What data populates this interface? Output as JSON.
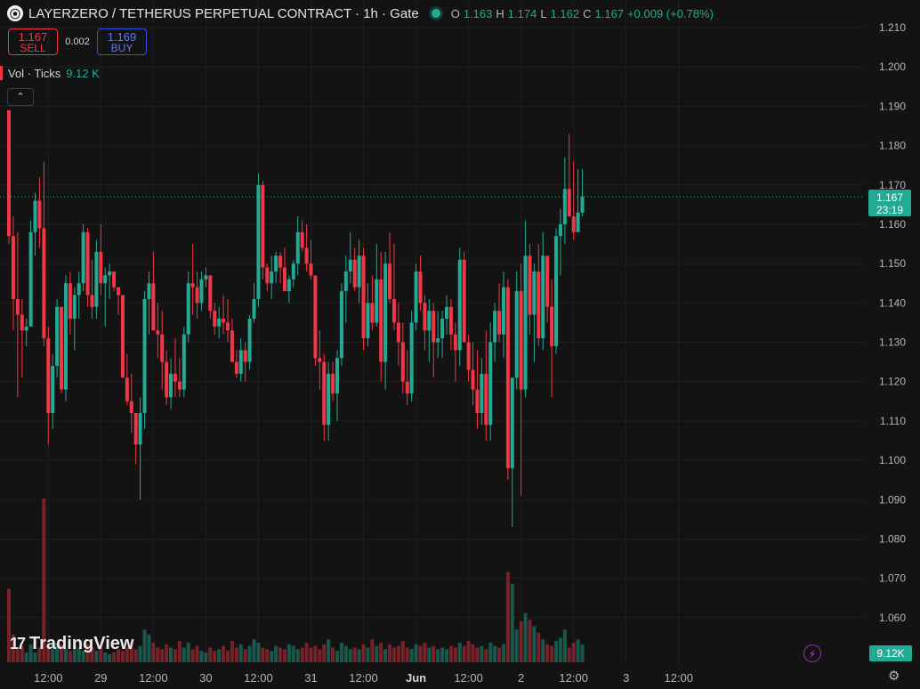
{
  "header": {
    "logo_letter": "⦿",
    "title": "LAYERZERO / TETHERUS PERPETUAL CONTRACT · 1h · Gate",
    "ohlc": {
      "o_label": "O",
      "o": "1.163",
      "h_label": "H",
      "h": "1.174",
      "l_label": "L",
      "l": "1.162",
      "c_label": "C",
      "c": "1.167",
      "change": "+0.009 (+0.78%)"
    }
  },
  "trade": {
    "sell_price": "1.167",
    "sell_label": "SELL",
    "spread": "0.002",
    "buy_price": "1.169",
    "buy_label": "BUY"
  },
  "volume_legend": {
    "label": "Vol · Ticks",
    "value": "9.12 K"
  },
  "brand": {
    "name": "TradingView",
    "mark": "17"
  },
  "colors": {
    "up": "#22ab94",
    "down": "#f23645",
    "background": "#131313",
    "grid": "#1f1f1f",
    "axis_text": "#b2b5be"
  },
  "icons": [
    "tradingview-logo-icon",
    "chevron-up-icon",
    "lightning-icon",
    "settings-icon"
  ],
  "chart_data": {
    "type": "candlestick",
    "interval": "1h",
    "ylim": [
      1.05,
      1.21
    ],
    "y_ticks": [
      "1.210",
      "1.200",
      "1.190",
      "1.180",
      "1.170",
      "1.160",
      "1.150",
      "1.140",
      "1.130",
      "1.120",
      "1.110",
      "1.100",
      "1.090",
      "1.080",
      "1.070",
      "1.060"
    ],
    "x_ticks": [
      "12:00",
      "29",
      "12:00",
      "30",
      "12:00",
      "31",
      "12:00",
      "Jun",
      "12:00",
      "2",
      "12:00",
      "3",
      "12:00"
    ],
    "x_tick_bars": [
      9,
      21,
      33,
      45,
      57,
      69,
      81,
      93,
      105,
      117,
      129,
      141,
      153
    ],
    "last_price": "1.167",
    "countdown": "23:19",
    "volume_last": "9.12K",
    "volume_max": 100,
    "candles": [
      [
        1.189,
        1.189,
        1.155,
        1.157,
        45
      ],
      [
        1.157,
        1.162,
        1.133,
        1.141,
        17
      ],
      [
        1.141,
        1.158,
        1.116,
        1.137,
        8
      ],
      [
        1.137,
        1.141,
        1.121,
        1.133,
        10
      ],
      [
        1.133,
        1.136,
        1.129,
        1.134,
        6
      ],
      [
        1.134,
        1.161,
        1.134,
        1.158,
        11
      ],
      [
        1.158,
        1.168,
        1.152,
        1.166,
        6
      ],
      [
        1.166,
        1.172,
        1.154,
        1.159,
        9
      ],
      [
        1.159,
        1.176,
        1.129,
        1.131,
        100
      ],
      [
        1.131,
        1.134,
        1.104,
        1.112,
        10
      ],
      [
        1.112,
        1.127,
        1.108,
        1.124,
        8
      ],
      [
        1.124,
        1.141,
        1.121,
        1.139,
        12
      ],
      [
        1.139,
        1.139,
        1.117,
        1.118,
        11
      ],
      [
        1.118,
        1.147,
        1.115,
        1.145,
        8
      ],
      [
        1.145,
        1.148,
        1.132,
        1.136,
        7
      ],
      [
        1.136,
        1.144,
        1.128,
        1.142,
        11
      ],
      [
        1.142,
        1.148,
        1.136,
        1.145,
        9
      ],
      [
        1.145,
        1.16,
        1.143,
        1.158,
        7
      ],
      [
        1.158,
        1.159,
        1.139,
        1.142,
        11
      ],
      [
        1.142,
        1.151,
        1.136,
        1.139,
        9
      ],
      [
        1.139,
        1.156,
        1.136,
        1.153,
        7
      ],
      [
        1.153,
        1.16,
        1.142,
        1.145,
        10
      ],
      [
        1.145,
        1.149,
        1.134,
        1.147,
        6
      ],
      [
        1.147,
        1.15,
        1.141,
        1.148,
        5
      ],
      [
        1.148,
        1.147,
        1.143,
        1.144,
        6
      ],
      [
        1.144,
        1.143,
        1.137,
        1.142,
        8
      ],
      [
        1.142,
        1.14,
        1.128,
        1.121,
        7
      ],
      [
        1.121,
        1.127,
        1.114,
        1.115,
        9
      ],
      [
        1.115,
        1.122,
        1.107,
        1.112,
        12
      ],
      [
        1.112,
        1.108,
        1.099,
        1.104,
        8
      ],
      [
        1.104,
        1.116,
        1.09,
        1.112,
        10
      ],
      [
        1.112,
        1.143,
        1.108,
        1.141,
        20
      ],
      [
        1.141,
        1.148,
        1.132,
        1.145,
        17
      ],
      [
        1.145,
        1.153,
        1.14,
        1.133,
        12
      ],
      [
        1.133,
        1.14,
        1.126,
        1.132,
        9
      ],
      [
        1.132,
        1.138,
        1.118,
        1.125,
        8
      ],
      [
        1.125,
        1.128,
        1.114,
        1.116,
        11
      ],
      [
        1.116,
        1.126,
        1.113,
        1.122,
        9
      ],
      [
        1.122,
        1.131,
        1.116,
        1.12,
        8
      ],
      [
        1.12,
        1.126,
        1.116,
        1.118,
        13
      ],
      [
        1.118,
        1.134,
        1.116,
        1.132,
        9
      ],
      [
        1.132,
        1.148,
        1.13,
        1.145,
        12
      ],
      [
        1.145,
        1.155,
        1.137,
        1.144,
        8
      ],
      [
        1.144,
        1.148,
        1.136,
        1.14,
        10
      ],
      [
        1.14,
        1.148,
        1.138,
        1.146,
        7
      ],
      [
        1.146,
        1.149,
        1.144,
        1.147,
        6
      ],
      [
        1.147,
        1.14,
        1.136,
        1.138,
        9
      ],
      [
        1.138,
        1.14,
        1.132,
        1.134,
        7
      ],
      [
        1.134,
        1.139,
        1.131,
        1.136,
        8
      ],
      [
        1.136,
        1.142,
        1.132,
        1.135,
        10
      ],
      [
        1.135,
        1.141,
        1.13,
        1.133,
        7
      ],
      [
        1.133,
        1.136,
        1.128,
        1.125,
        13
      ],
      [
        1.125,
        1.128,
        1.121,
        1.122,
        9
      ],
      [
        1.122,
        1.131,
        1.12,
        1.128,
        11
      ],
      [
        1.128,
        1.13,
        1.12,
        1.125,
        8
      ],
      [
        1.125,
        1.137,
        1.123,
        1.136,
        10
      ],
      [
        1.136,
        1.145,
        1.135,
        1.141,
        14
      ],
      [
        1.141,
        1.173,
        1.139,
        1.17,
        12
      ],
      [
        1.17,
        1.171,
        1.146,
        1.149,
        9
      ],
      [
        1.149,
        1.15,
        1.143,
        1.145,
        8
      ],
      [
        1.145,
        1.152,
        1.141,
        1.148,
        7
      ],
      [
        1.148,
        1.153,
        1.145,
        1.152,
        10
      ],
      [
        1.152,
        1.153,
        1.145,
        1.149,
        9
      ],
      [
        1.149,
        1.154,
        1.144,
        1.143,
        8
      ],
      [
        1.143,
        1.147,
        1.14,
        1.146,
        11
      ],
      [
        1.146,
        1.151,
        1.144,
        1.15,
        10
      ],
      [
        1.15,
        1.162,
        1.147,
        1.158,
        8
      ],
      [
        1.158,
        1.161,
        1.153,
        1.154,
        9
      ],
      [
        1.154,
        1.16,
        1.148,
        1.15,
        12
      ],
      [
        1.15,
        1.156,
        1.146,
        1.147,
        9
      ],
      [
        1.147,
        1.139,
        1.124,
        1.126,
        10
      ],
      [
        1.126,
        1.133,
        1.118,
        1.125,
        8
      ],
      [
        1.125,
        1.127,
        1.105,
        1.109,
        11
      ],
      [
        1.109,
        1.125,
        1.105,
        1.122,
        14
      ],
      [
        1.122,
        1.125,
        1.115,
        1.117,
        9
      ],
      [
        1.117,
        1.128,
        1.11,
        1.126,
        7
      ],
      [
        1.126,
        1.145,
        1.124,
        1.143,
        12
      ],
      [
        1.143,
        1.152,
        1.135,
        1.148,
        10
      ],
      [
        1.148,
        1.158,
        1.145,
        1.151,
        8
      ],
      [
        1.151,
        1.154,
        1.143,
        1.144,
        9
      ],
      [
        1.144,
        1.156,
        1.14,
        1.152,
        8
      ],
      [
        1.152,
        1.154,
        1.128,
        1.131,
        11
      ],
      [
        1.131,
        1.145,
        1.129,
        1.14,
        9
      ],
      [
        1.14,
        1.147,
        1.133,
        1.135,
        14
      ],
      [
        1.135,
        1.155,
        1.134,
        1.146,
        10
      ],
      [
        1.146,
        1.153,
        1.12,
        1.125,
        12
      ],
      [
        1.125,
        1.153,
        1.118,
        1.15,
        8
      ],
      [
        1.15,
        1.158,
        1.14,
        1.141,
        11
      ],
      [
        1.141,
        1.155,
        1.133,
        1.135,
        9
      ],
      [
        1.135,
        1.14,
        1.124,
        1.13,
        10
      ],
      [
        1.13,
        1.135,
        1.117,
        1.12,
        13
      ],
      [
        1.12,
        1.128,
        1.114,
        1.117,
        9
      ],
      [
        1.117,
        1.138,
        1.115,
        1.135,
        8
      ],
      [
        1.135,
        1.15,
        1.133,
        1.148,
        11
      ],
      [
        1.148,
        1.152,
        1.138,
        1.14,
        10
      ],
      [
        1.14,
        1.142,
        1.128,
        1.133,
        12
      ],
      [
        1.133,
        1.141,
        1.125,
        1.138,
        9
      ],
      [
        1.138,
        1.14,
        1.121,
        1.13,
        10
      ],
      [
        1.13,
        1.138,
        1.126,
        1.131,
        8
      ],
      [
        1.131,
        1.138,
        1.126,
        1.136,
        9
      ],
      [
        1.136,
        1.142,
        1.132,
        1.139,
        8
      ],
      [
        1.139,
        1.141,
        1.128,
        1.132,
        10
      ],
      [
        1.132,
        1.135,
        1.12,
        1.128,
        9
      ],
      [
        1.128,
        1.154,
        1.124,
        1.151,
        12
      ],
      [
        1.151,
        1.153,
        1.133,
        1.13,
        10
      ],
      [
        1.13,
        1.132,
        1.12,
        1.123,
        13
      ],
      [
        1.123,
        1.13,
        1.114,
        1.118,
        11
      ],
      [
        1.118,
        1.128,
        1.108,
        1.112,
        9
      ],
      [
        1.112,
        1.126,
        1.109,
        1.122,
        10
      ],
      [
        1.122,
        1.133,
        1.105,
        1.109,
        8
      ],
      [
        1.109,
        1.135,
        1.105,
        1.13,
        12
      ],
      [
        1.13,
        1.14,
        1.125,
        1.138,
        10
      ],
      [
        1.138,
        1.145,
        1.13,
        1.132,
        9
      ],
      [
        1.132,
        1.148,
        1.126,
        1.144,
        11
      ],
      [
        1.144,
        1.146,
        1.095,
        1.098,
        55
      ],
      [
        1.098,
        1.11,
        1.083,
        1.121,
        48
      ],
      [
        1.121,
        1.148,
        1.118,
        1.143,
        20
      ],
      [
        1.143,
        1.15,
        1.091,
        1.118,
        25
      ],
      [
        1.118,
        1.161,
        1.116,
        1.152,
        30
      ],
      [
        1.152,
        1.155,
        1.132,
        1.137,
        26
      ],
      [
        1.137,
        1.15,
        1.125,
        1.148,
        22
      ],
      [
        1.148,
        1.155,
        1.129,
        1.131,
        18
      ],
      [
        1.131,
        1.158,
        1.128,
        1.152,
        14
      ],
      [
        1.152,
        1.148,
        1.135,
        1.139,
        11
      ],
      [
        1.139,
        1.146,
        1.116,
        1.129,
        10
      ],
      [
        1.129,
        1.159,
        1.127,
        1.157,
        13
      ],
      [
        1.157,
        1.164,
        1.147,
        1.16,
        15
      ],
      [
        1.16,
        1.177,
        1.155,
        1.169,
        20
      ],
      [
        1.169,
        1.183,
        1.167,
        1.162,
        9
      ],
      [
        1.162,
        1.176,
        1.156,
        1.158,
        12
      ],
      [
        1.158,
        1.174,
        1.161,
        1.163,
        14
      ],
      [
        1.163,
        1.174,
        1.162,
        1.167,
        11
      ]
    ]
  }
}
